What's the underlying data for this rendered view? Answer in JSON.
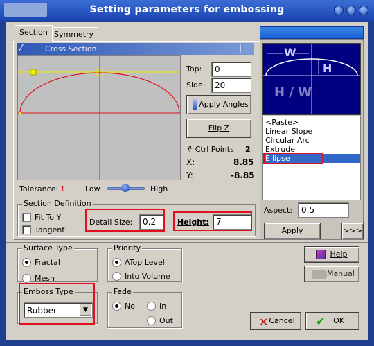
{
  "window": {
    "title": "Setting parameters for embossing"
  },
  "tabs": [
    {
      "label": "Section"
    },
    {
      "label": "Symmetry"
    }
  ],
  "cross_section": {
    "header": "Cross Section",
    "tolerance_label": "Tolerance:",
    "tolerance_value": "1",
    "slider_low": "Low",
    "slider_high": "High"
  },
  "params": {
    "top_label": "Top:",
    "top_value": "0",
    "side_label": "Side:",
    "side_value": "20",
    "apply_angles": "Apply Angles",
    "flip_z": "Flip Z",
    "ctrl_points_label": "# Ctrl Points",
    "ctrl_points_value": "2",
    "x_label": "X:",
    "x_value": "8.85",
    "y_label": "Y:",
    "y_value": "-8.85"
  },
  "section_definition": {
    "title": "Section Definition",
    "fit_to_y": "Fit To Y",
    "tangent": "Tangent",
    "detail_size_label": "Detail Size:",
    "detail_size_value": "0.2",
    "height_label": "Height:",
    "height_value": "7"
  },
  "preview": {
    "w_label": "W",
    "h_label": "H",
    "hw_label": "H / W"
  },
  "profiles": {
    "items": [
      "<Paste>",
      "Linear Slope",
      "Circular Arc",
      "Extrude",
      "Ellipse"
    ],
    "selected": "Ellipse"
  },
  "aspect": {
    "label": "Aspect:",
    "value": "0.5"
  },
  "apply_button": "Apply",
  "more_button": ">>>",
  "surface_type": {
    "title": "Surface Type",
    "options": [
      "Fractal",
      "Mesh"
    ],
    "selected": "Fractal"
  },
  "priority": {
    "title": "Priority",
    "options": [
      "ATop Level",
      "Into Volume"
    ],
    "selected": "ATop Level"
  },
  "emboss_type": {
    "title": "Emboss Type",
    "value": "Rubber"
  },
  "fade": {
    "title": "Fade",
    "options": [
      "No",
      "In",
      "Out"
    ],
    "selected": "No"
  },
  "help_button": "Help",
  "manual_button": "Manual",
  "cancel_button": "Cancel",
  "ok_button": "OK",
  "colors": {
    "title_blue": "#1e3e8e",
    "dialog_gray": "#d4d0c8",
    "highlight_red": "#e01020",
    "preview_bg": "#000080"
  }
}
